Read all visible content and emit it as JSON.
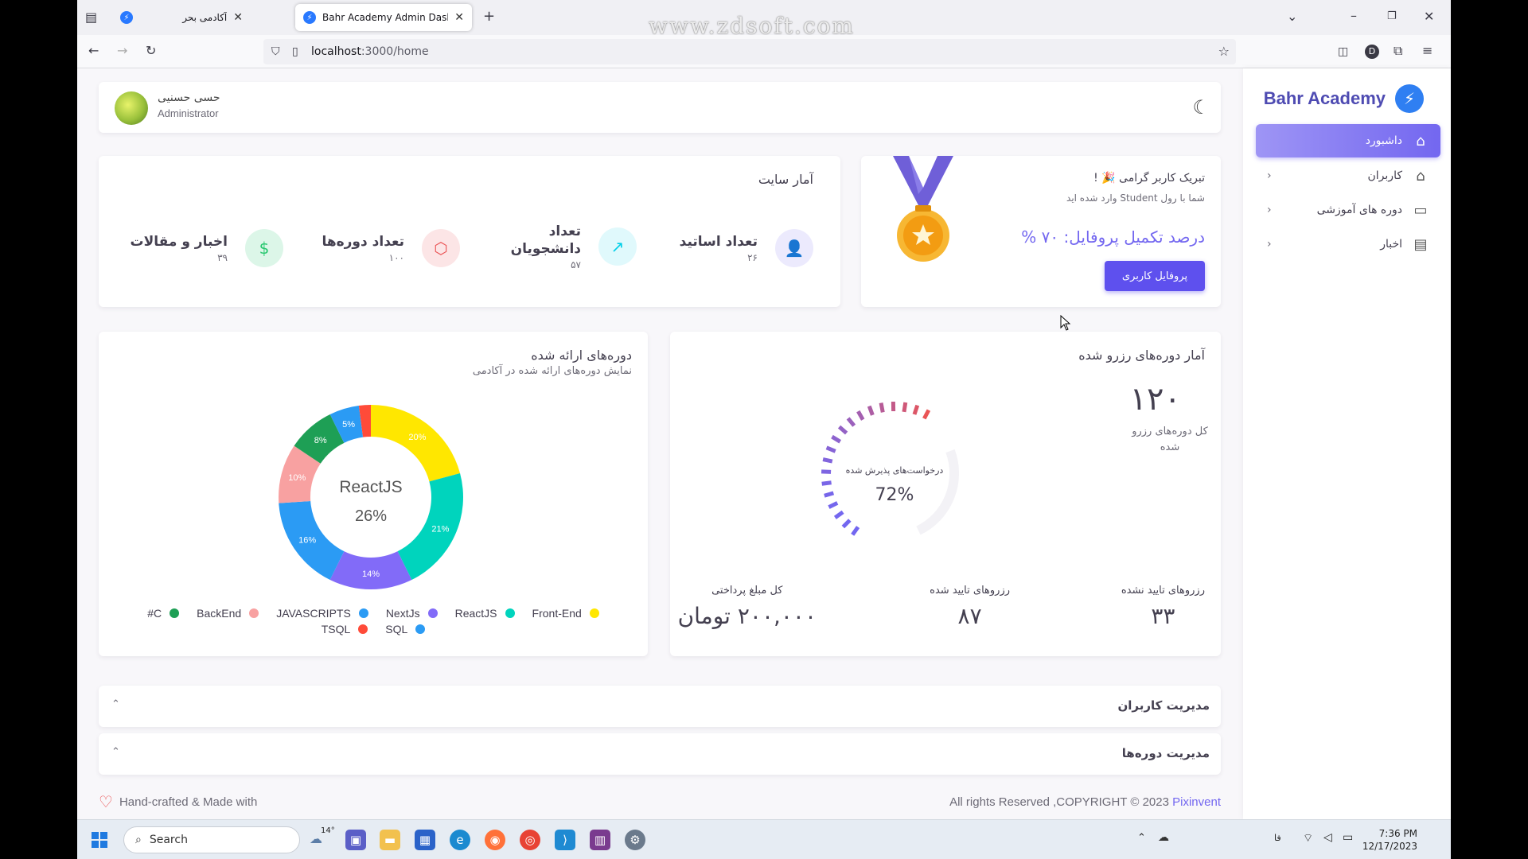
{
  "browser": {
    "tabs": [
      {
        "title": "آکادمی بحر"
      },
      {
        "title": "Bahr Academy Admin Dashboa"
      }
    ],
    "url_host": "localhost",
    "url_path": ":3000/home",
    "watermark": "www.zdsoft.com"
  },
  "sidebar": {
    "brand": "Bahr Academy",
    "items": [
      {
        "label": "داشبورد",
        "icon": "home-icon"
      },
      {
        "label": "کاربران",
        "icon": "home-icon"
      },
      {
        "label": "دوره های آموزشی",
        "icon": "monitor-icon"
      },
      {
        "label": "اخبار",
        "icon": "document-icon"
      }
    ]
  },
  "header": {
    "user_name": "حسی حسنیی",
    "user_role": "Administrator"
  },
  "congrats": {
    "title": "تبریک کاربر گرامی 🎉 !",
    "subtitle": "شما با رول Student وارد شده اید",
    "progress_text": "درصد تکمیل پروفایل: ۷۰ %",
    "button": "پروفایل کاربری"
  },
  "site_stats": {
    "title": "آمار سایت",
    "items": [
      {
        "label": "تعداد اساتید",
        "value": "۲۶",
        "icon": "user-icon",
        "color": "#7367f0",
        "bg": "#eceafd"
      },
      {
        "label": "تعداد دانشجویان",
        "value": "۵۷",
        "icon": "trending-up-icon",
        "color": "#00cfe8",
        "bg": "#e0f9fc"
      },
      {
        "label": "تعداد دوره‌ها",
        "value": "۱۰۰",
        "icon": "box-icon",
        "color": "#ea5455",
        "bg": "#fce5e6"
      },
      {
        "label": "اخبار و مقالات",
        "value": "۳۹",
        "icon": "dollar-icon",
        "color": "#28c76f",
        "bg": "#dcf6e8"
      }
    ]
  },
  "reserved": {
    "title": "آمار دوره‌های رزرو شده",
    "total": "۱۲۰",
    "total_label": "کل دوره‌های رزرو شده",
    "gauge_label": "درخواست‌های پذیرش شده",
    "gauge_value": 72,
    "gauge_text": "72%",
    "bottom": [
      {
        "label": "رزروهای تایید نشده",
        "value": "۳۳"
      },
      {
        "label": "رزروهای تایید شده",
        "value": "۸۷"
      },
      {
        "label": "کل مبلغ پرداختی",
        "value": "۲۰۰,۰۰۰ تومان"
      }
    ]
  },
  "courses": {
    "title": "دوره‌های ارائه شده",
    "subtitle": "نمایش دوره‌های ارائه شده در آکادمی",
    "center_label": "ReactJS",
    "center_value": "26%"
  },
  "chart_data": {
    "type": "pie",
    "title": "دوره‌های ارائه شده",
    "series": [
      {
        "name": "Front-End",
        "value": 20,
        "label": "20%",
        "color": "#ffe700"
      },
      {
        "name": "ReactJS",
        "value": 21,
        "label": "21%",
        "color": "#00d4bd"
      },
      {
        "name": "NextJs",
        "value": 14,
        "label": "14%",
        "color": "#826bf8"
      },
      {
        "name": "JAVASCRIPTS",
        "value": 16,
        "label": "16%",
        "color": "#2b9bf4"
      },
      {
        "name": "BackEnd",
        "value": 10,
        "label": "10%",
        "color": "#f8a1a1"
      },
      {
        "name": "#C",
        "value": 8,
        "label": "8%",
        "color": "#1e9f55"
      },
      {
        "name": "SQL",
        "value": 5,
        "label": "5%",
        "color": "#2b9bf4"
      },
      {
        "name": "TSQL",
        "value": 2,
        "label": "",
        "color": "#ff4b39"
      }
    ]
  },
  "panels": [
    {
      "title": "مدیریت کاربران"
    },
    {
      "title": "مدیریت دوره‌ها"
    }
  ],
  "footer": {
    "left": "Hand-crafted & Made with",
    "right": "All rights Reserved ,COPYRIGHT © 2023 ",
    "link": "Pixinvent"
  },
  "taskbar": {
    "search": "Search",
    "weather": "14°",
    "time": "7:36 PM",
    "date": "12/17/2023",
    "lang": "فا"
  }
}
